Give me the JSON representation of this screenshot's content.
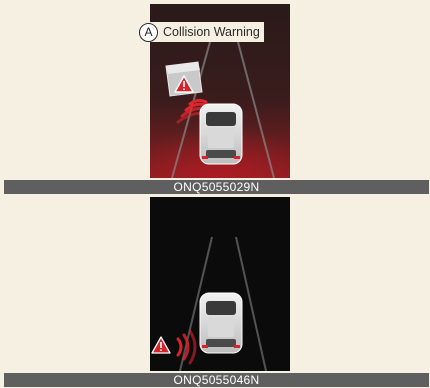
{
  "top_panel": {
    "label_marker": "A",
    "label_text": "Collision Warning",
    "caption": "ONQ5055029N"
  },
  "bottom_panel": {
    "caption": "ONQ5055046N"
  },
  "colors": {
    "page_bg": "#f6f0e3",
    "screen_dark": "#1a1a1a",
    "warning_red": "#d8232a",
    "caption_bg": "#5f5f5f"
  },
  "icons": [
    "warning-triangle-icon",
    "car-icon",
    "radar-wave-icon"
  ]
}
